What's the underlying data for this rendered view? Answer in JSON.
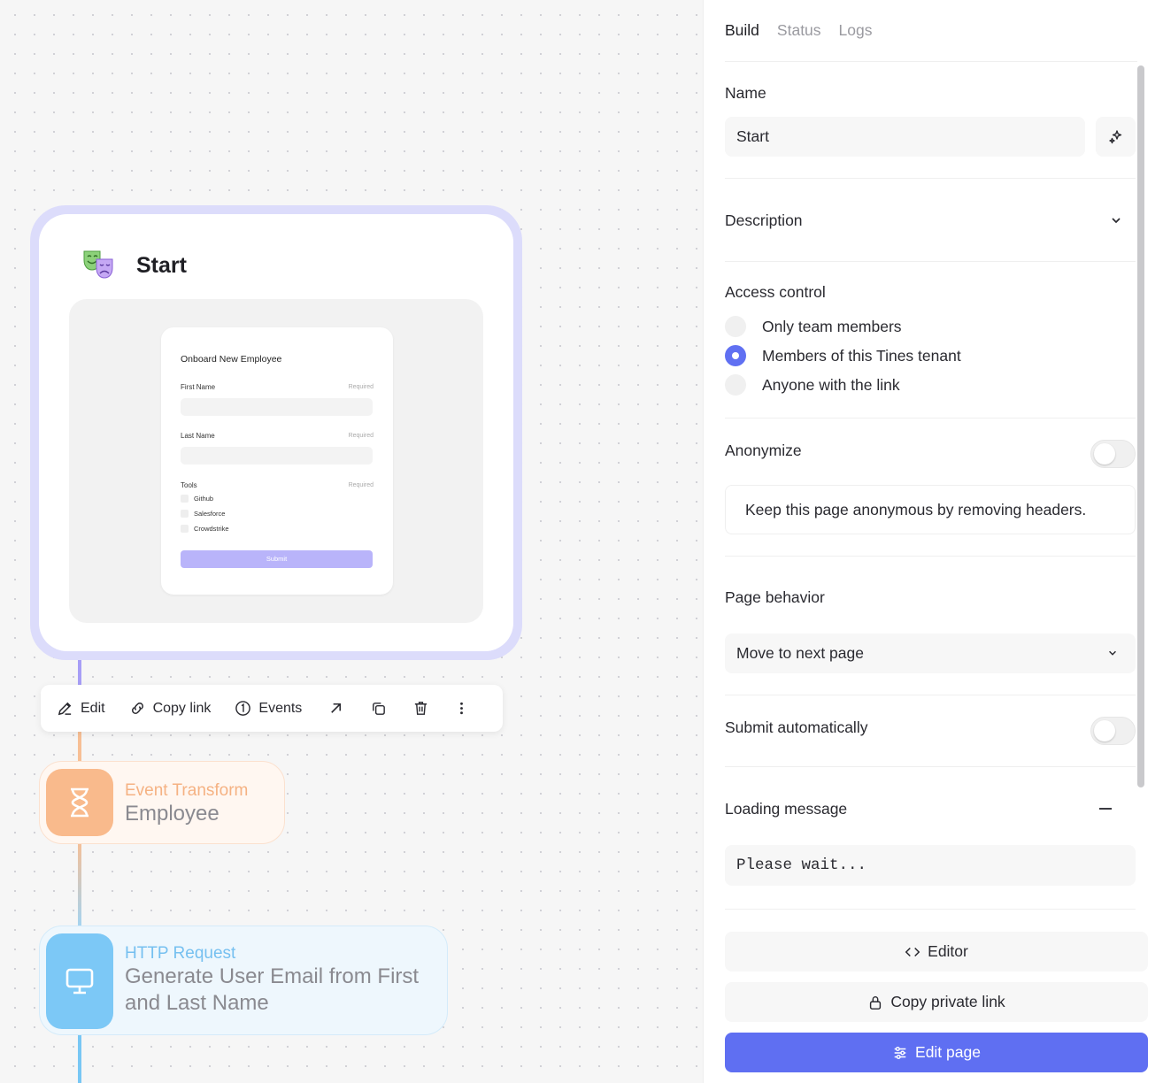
{
  "canvas": {
    "start_node": {
      "title": "Start",
      "form_preview": {
        "title": "Onboard New Employee",
        "fields": [
          {
            "label": "First Name",
            "required": "Required"
          },
          {
            "label": "Last Name",
            "required": "Required"
          },
          {
            "label": "Tools",
            "required": "Required"
          }
        ],
        "options": [
          "Github",
          "Salesforce",
          "Crowdstrike"
        ],
        "submit_label": "Submit"
      }
    },
    "toolbar": {
      "edit_label": "Edit",
      "copy_link_label": "Copy link",
      "events_label": "Events"
    },
    "transform_node": {
      "type": "Event Transform",
      "name": "Employee"
    },
    "http_node": {
      "type": "HTTP Request",
      "name": "Generate User Email from First and Last Name"
    },
    "colors": {
      "start_border": "#dcdcfb",
      "transform_badge": "#f9ba8c",
      "http_badge": "#7cc8f6",
      "primary": "#5f6ff2"
    }
  },
  "panel": {
    "tabs": [
      {
        "label": "Build",
        "active": true
      },
      {
        "label": "Status",
        "active": false
      },
      {
        "label": "Logs",
        "active": false
      }
    ],
    "name": {
      "label": "Name",
      "value": "Start"
    },
    "description": {
      "label": "Description"
    },
    "access_control": {
      "label": "Access control",
      "options": [
        {
          "label": "Only team members",
          "checked": false
        },
        {
          "label": "Members of this Tines tenant",
          "checked": true
        },
        {
          "label": "Anyone with the link",
          "checked": false
        }
      ]
    },
    "anonymize": {
      "label": "Anonymize",
      "enabled": false,
      "hint": "Keep this page anonymous by removing headers."
    },
    "page_behavior": {
      "label": "Page behavior",
      "value": "Move to next page"
    },
    "submit_automatically": {
      "label": "Submit automatically",
      "enabled": false
    },
    "loading_message": {
      "label": "Loading message",
      "value": "Please wait..."
    },
    "buttons": {
      "editor": "Editor",
      "copy_private_link": "Copy private link",
      "edit_page": "Edit page"
    }
  }
}
